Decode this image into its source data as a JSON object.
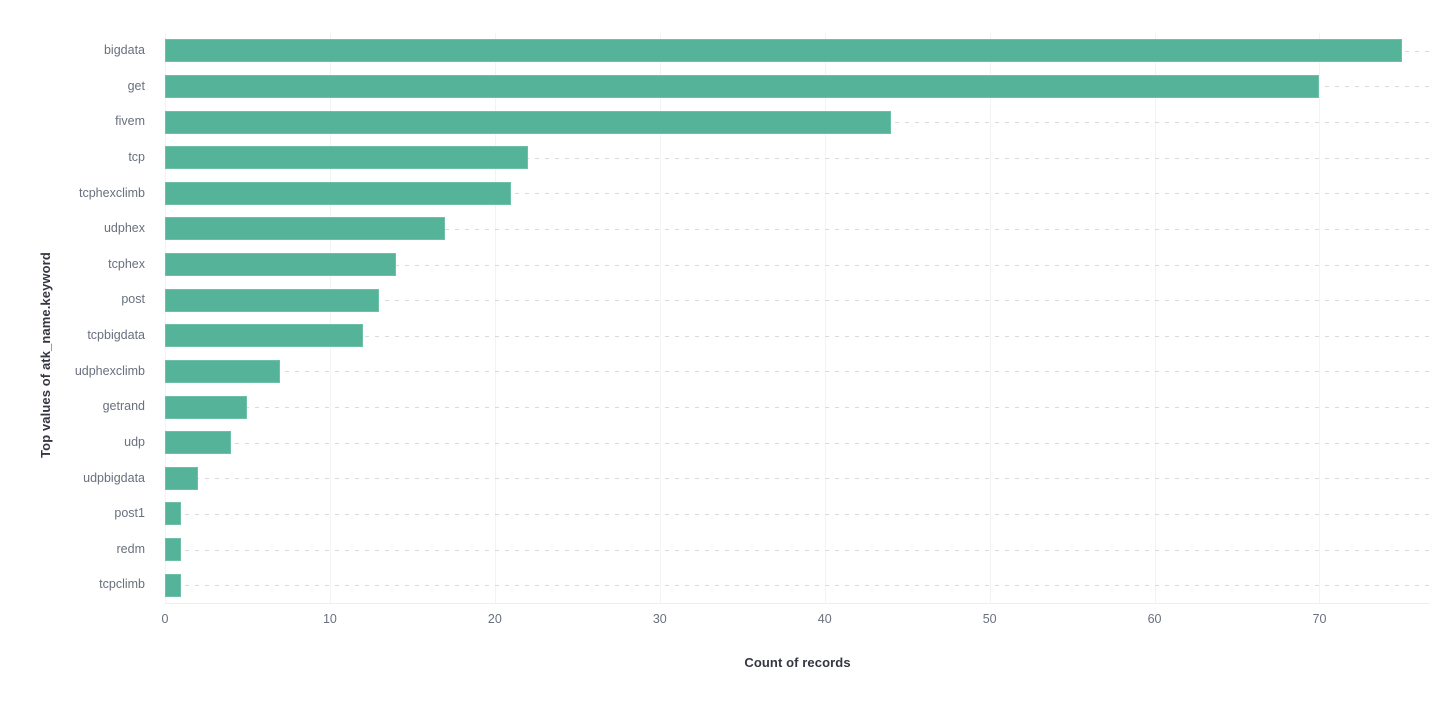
{
  "chart_data": {
    "type": "bar",
    "orientation": "horizontal",
    "title": "",
    "xlabel": "Count of records",
    "ylabel": "Top values of atk_name.keyword",
    "categories": [
      "bigdata",
      "get",
      "fivem",
      "tcp",
      "tcphexclimb",
      "udphex",
      "tcphex",
      "post",
      "tcpbigdata",
      "udphexclimb",
      "getrand",
      "udp",
      "udpbigdata",
      "post1",
      "redm",
      "tcpclimb"
    ],
    "values": [
      75,
      70,
      44,
      22,
      21,
      17,
      14,
      13,
      12,
      7,
      5,
      4,
      2,
      1,
      1,
      1
    ],
    "xlim": [
      0,
      76.7
    ],
    "xticks": [
      0,
      10,
      20,
      30,
      40,
      50,
      60,
      70
    ],
    "xtick_labels": [
      "0",
      "10",
      "20",
      "30",
      "40",
      "50",
      "60",
      "70"
    ],
    "grid": {
      "vertical": true,
      "horizontal_dashed": true
    },
    "legend": null,
    "colors": {
      "bar_fill": "#54b399",
      "bar_stroke": "#6dbfa8",
      "gridline": "#f2f3f4",
      "dashed_gridline": "#d8dade",
      "tick_label": "#69707d",
      "axis_title": "#343741",
      "background": "#ffffff"
    }
  }
}
